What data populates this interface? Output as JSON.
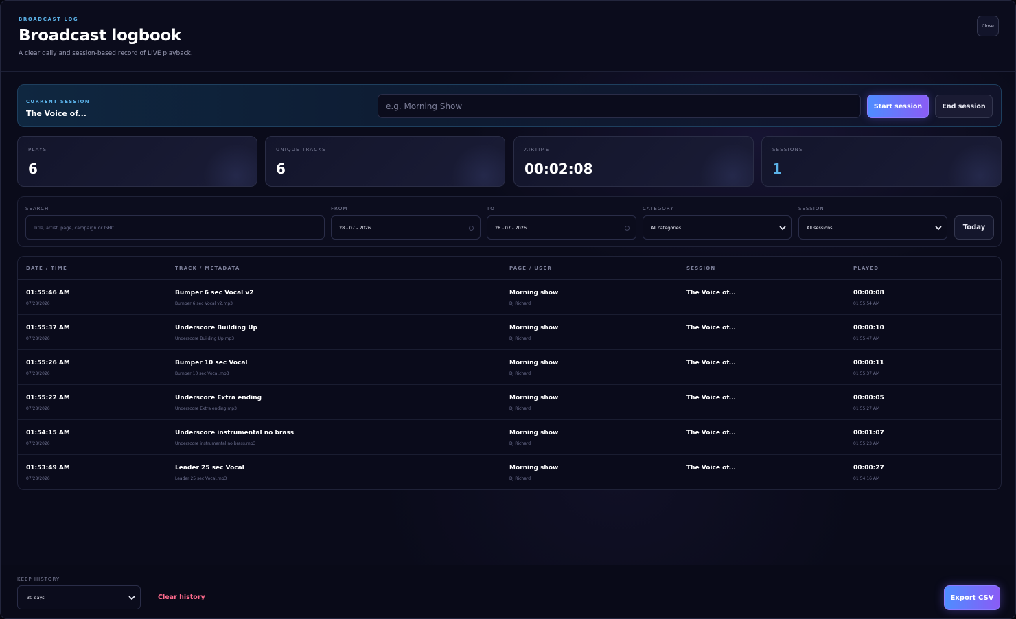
{
  "header": {
    "eyebrow": "BROADCAST LOG",
    "title": "Broadcast logbook",
    "subtitle": "A clear daily and session-based record of LIVE playback.",
    "close_label": "Close"
  },
  "session": {
    "label": "CURRENT SESSION",
    "value": "The Voice of...",
    "input_placeholder": "e.g. Morning Show",
    "start_label": "Start session",
    "end_label": "End session"
  },
  "stats": [
    {
      "label": "PLAYS",
      "value": "6"
    },
    {
      "label": "UNIQUE TRACKS",
      "value": "6"
    },
    {
      "label": "AIRTIME",
      "value": "00:02:08"
    },
    {
      "label": "SESSIONS",
      "value": "1"
    }
  ],
  "filters": {
    "search_label": "SEARCH",
    "search_placeholder": "Title, artist, page, campaign or ISRC",
    "from_label": "FROM",
    "from_value": "28 - 07 - 2026",
    "to_label": "TO",
    "to_value": "28 - 07 - 2026",
    "category_label": "CATEGORY",
    "category_value": "All categories",
    "session_label": "SESSION",
    "session_value": "All sessions",
    "today_label": "Today"
  },
  "table": {
    "headers": [
      "DATE / TIME",
      "TRACK / METADATA",
      "PAGE / USER",
      "SESSION",
      "PLAYED"
    ],
    "rows": [
      {
        "time": "01:55:46 AM",
        "date": "07/28/2026",
        "track": "Bumper 6 sec Vocal v2",
        "file": "Bumper 6 sec Vocal v2.mp3",
        "page": "Morning show",
        "user": "DJ Richard",
        "session": "The Voice of...",
        "played": "00:00:08",
        "played_at": "01:55:54 AM"
      },
      {
        "time": "01:55:37 AM",
        "date": "07/28/2026",
        "track": "Underscore Building Up",
        "file": "Underscore Building Up.mp3",
        "page": "Morning show",
        "user": "DJ Richard",
        "session": "The Voice of...",
        "played": "00:00:10",
        "played_at": "01:55:47 AM"
      },
      {
        "time": "01:55:26 AM",
        "date": "07/28/2026",
        "track": "Bumper 10 sec Vocal",
        "file": "Bumper 10 sec Vocal.mp3",
        "page": "Morning show",
        "user": "DJ Richard",
        "session": "The Voice of...",
        "played": "00:00:11",
        "played_at": "01:55:37 AM"
      },
      {
        "time": "01:55:22 AM",
        "date": "07/28/2026",
        "track": "Underscore Extra ending",
        "file": "Underscore Extra ending.mp3",
        "page": "Morning show",
        "user": "DJ Richard",
        "session": "The Voice of...",
        "played": "00:00:05",
        "played_at": "01:55:27 AM"
      },
      {
        "time": "01:54:15 AM",
        "date": "07/28/2026",
        "track": "Underscore instrumental no brass",
        "file": "Underscore instrumental no brass.mp3",
        "page": "Morning show",
        "user": "DJ Richard",
        "session": "The Voice of...",
        "played": "00:01:07",
        "played_at": "01:55:23 AM"
      },
      {
        "time": "01:53:49 AM",
        "date": "07/28/2026",
        "track": "Leader 25 sec Vocal",
        "file": "Leader 25 sec Vocal.mp3",
        "page": "Morning show",
        "user": "DJ Richard",
        "session": "The Voice of...",
        "played": "00:00:27",
        "played_at": "01:54:16 AM"
      }
    ]
  },
  "footer": {
    "keep_label": "KEEP HISTORY",
    "keep_value": "30 days",
    "clear_label": "Clear history",
    "export_label": "Export CSV"
  },
  "icons": {
    "calendar": "calendar-icon",
    "chevron": "chevron-down-icon"
  },
  "colors": {
    "accent": "#5bb2e8",
    "danger": "#ff6b8d",
    "gradient_start": "#4e8dff",
    "gradient_end": "#8a5cf6"
  }
}
